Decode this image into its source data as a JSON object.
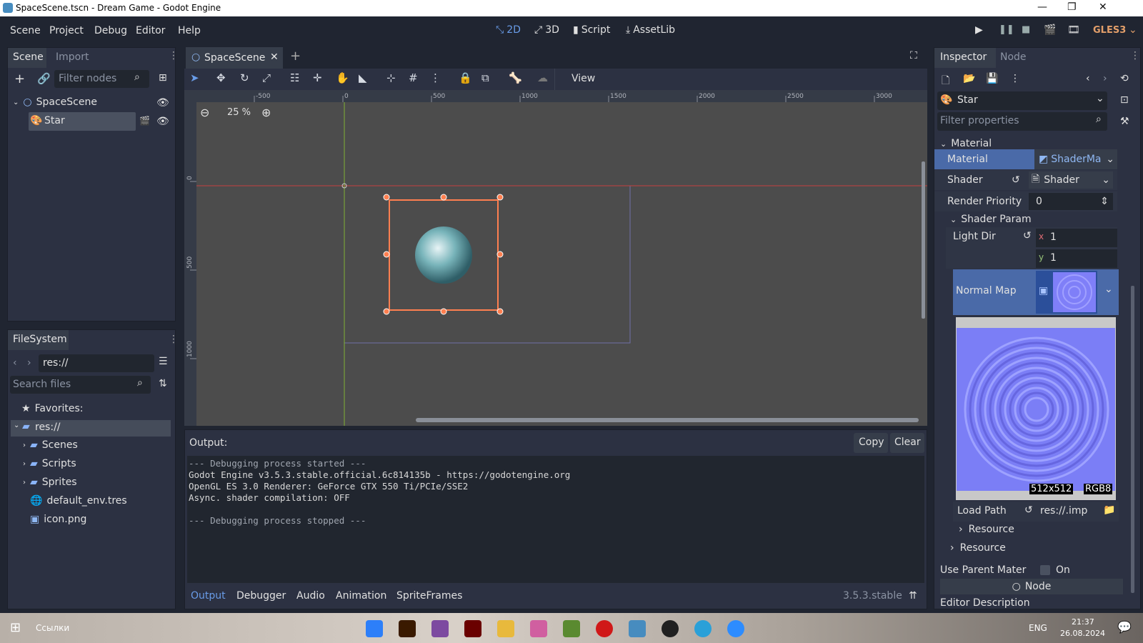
{
  "window": {
    "title": "SpaceScene.tscn - Dream Game - Godot Engine",
    "min": "—",
    "max": "❐",
    "close": "✕"
  },
  "menu": {
    "items": [
      "Scene",
      "Project",
      "Debug",
      "Editor",
      "Help"
    ]
  },
  "workspaces": {
    "w2d": "2D",
    "w3d": "3D",
    "script": "Script",
    "assetlib": "AssetLib"
  },
  "renderer": "GLES3",
  "scene_dock": {
    "tab_scene": "Scene",
    "tab_import": "Import",
    "filter_placeholder": "Filter nodes",
    "nodes": [
      {
        "name": "SpaceScene"
      },
      {
        "name": "Star"
      }
    ]
  },
  "filesystem": {
    "title": "FileSystem",
    "path": "res://",
    "search_placeholder": "Search files",
    "favorites": "Favorites:",
    "root": "res://",
    "items": [
      "Scenes",
      "Scripts",
      "Sprites",
      "default_env.tres",
      "icon.png"
    ]
  },
  "editor_tab": {
    "name": "SpaceScene",
    "close": "✕",
    "add": "+"
  },
  "toolbar": {
    "view": "View"
  },
  "viewport": {
    "zoom": "25 %",
    "ruler_top": [
      "-500",
      "0",
      "500",
      "1000",
      "1500",
      "2000",
      "2500",
      "3000"
    ],
    "ruler_left": [
      "0",
      "500",
      "1000"
    ]
  },
  "output": {
    "title": "Output:",
    "copy": "Copy",
    "clear": "Clear",
    "lines": [
      "--- Debugging process started ---",
      "Godot Engine v3.5.3.stable.official.6c814135b - https://godotengine.org",
      "OpenGL ES 3.0 Renderer: GeForce GTX 550 Ti/PCIe/SSE2",
      "Async. shader compilation: OFF",
      "",
      "--- Debugging process stopped ---"
    ],
    "tabs": [
      "Output",
      "Debugger",
      "Audio",
      "Animation",
      "SpriteFrames"
    ],
    "version": "3.5.3.stable"
  },
  "inspector": {
    "tab_inspector": "Inspector",
    "tab_node": "Node",
    "object": "Star",
    "filter_placeholder": "Filter properties",
    "section_material": "Material",
    "material_label": "Material",
    "material_value": "ShaderMa",
    "shader_label": "Shader",
    "shader_value": "Shader",
    "render_priority_label": "Render Priority",
    "render_priority_value": "0",
    "shader_param": "Shader Param",
    "light_dir_label": "Light Dir",
    "light_x_label": "x",
    "light_x": "1",
    "light_y_label": "y",
    "light_y": "1",
    "normal_map_label": "Normal Map",
    "texture_size": "512x512",
    "texture_format": "RGB8",
    "load_path_label": "Load Path",
    "load_path_value": "res://.imp",
    "resource_inner": "Resource",
    "resource_outer": "Resource",
    "use_parent_label": "Use Parent Mater",
    "use_parent_value": "On",
    "node_section": "Node",
    "editor_description": "Editor Description"
  },
  "taskbar": {
    "search": "Ссылки",
    "lang": "ENG",
    "time": "21:37",
    "date": "26.08.2024"
  },
  "colors": {
    "accent": "#699ce8",
    "selection": "#ff7f50",
    "bg": "#202531",
    "panel": "#2c3142"
  }
}
